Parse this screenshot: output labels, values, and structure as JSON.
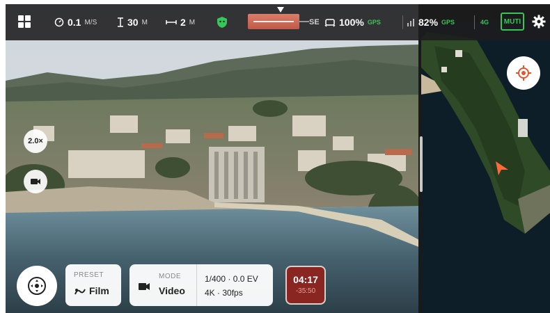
{
  "telemetry": {
    "speed_value": "0.1",
    "speed_unit": "M/S",
    "height_value": "30",
    "height_unit": "M",
    "distance_value": "2",
    "distance_unit": "M",
    "horizon_partial": "SE",
    "drone_battery": "100%",
    "gps_label": "GPS",
    "phone_battery": "82%",
    "gps_label_2": "GPS",
    "network": "4G",
    "mode_chip": "MUTI"
  },
  "camera": {
    "zoom_label": "2.0×"
  },
  "bottom": {
    "preset_label": "PRESET",
    "preset_value": "Film",
    "mode_label": "MODE",
    "mode_value": "Video",
    "exposure": "1/400 · 0.0 EV",
    "resolution": "4K · 30fps",
    "rec_time": "04:17",
    "rec_sub": "-35:50"
  },
  "colors": {
    "accent_green": "#37c659",
    "record_red": "#8a2621",
    "drone_marker": "#ff6a3d"
  },
  "icons": {
    "menu": "grid-icon",
    "speed": "speedometer-icon",
    "height": "height-icon",
    "distance": "distance-icon",
    "shield": "shield-icon",
    "battery": "drone-battery-icon",
    "settings": "gear-icon"
  }
}
